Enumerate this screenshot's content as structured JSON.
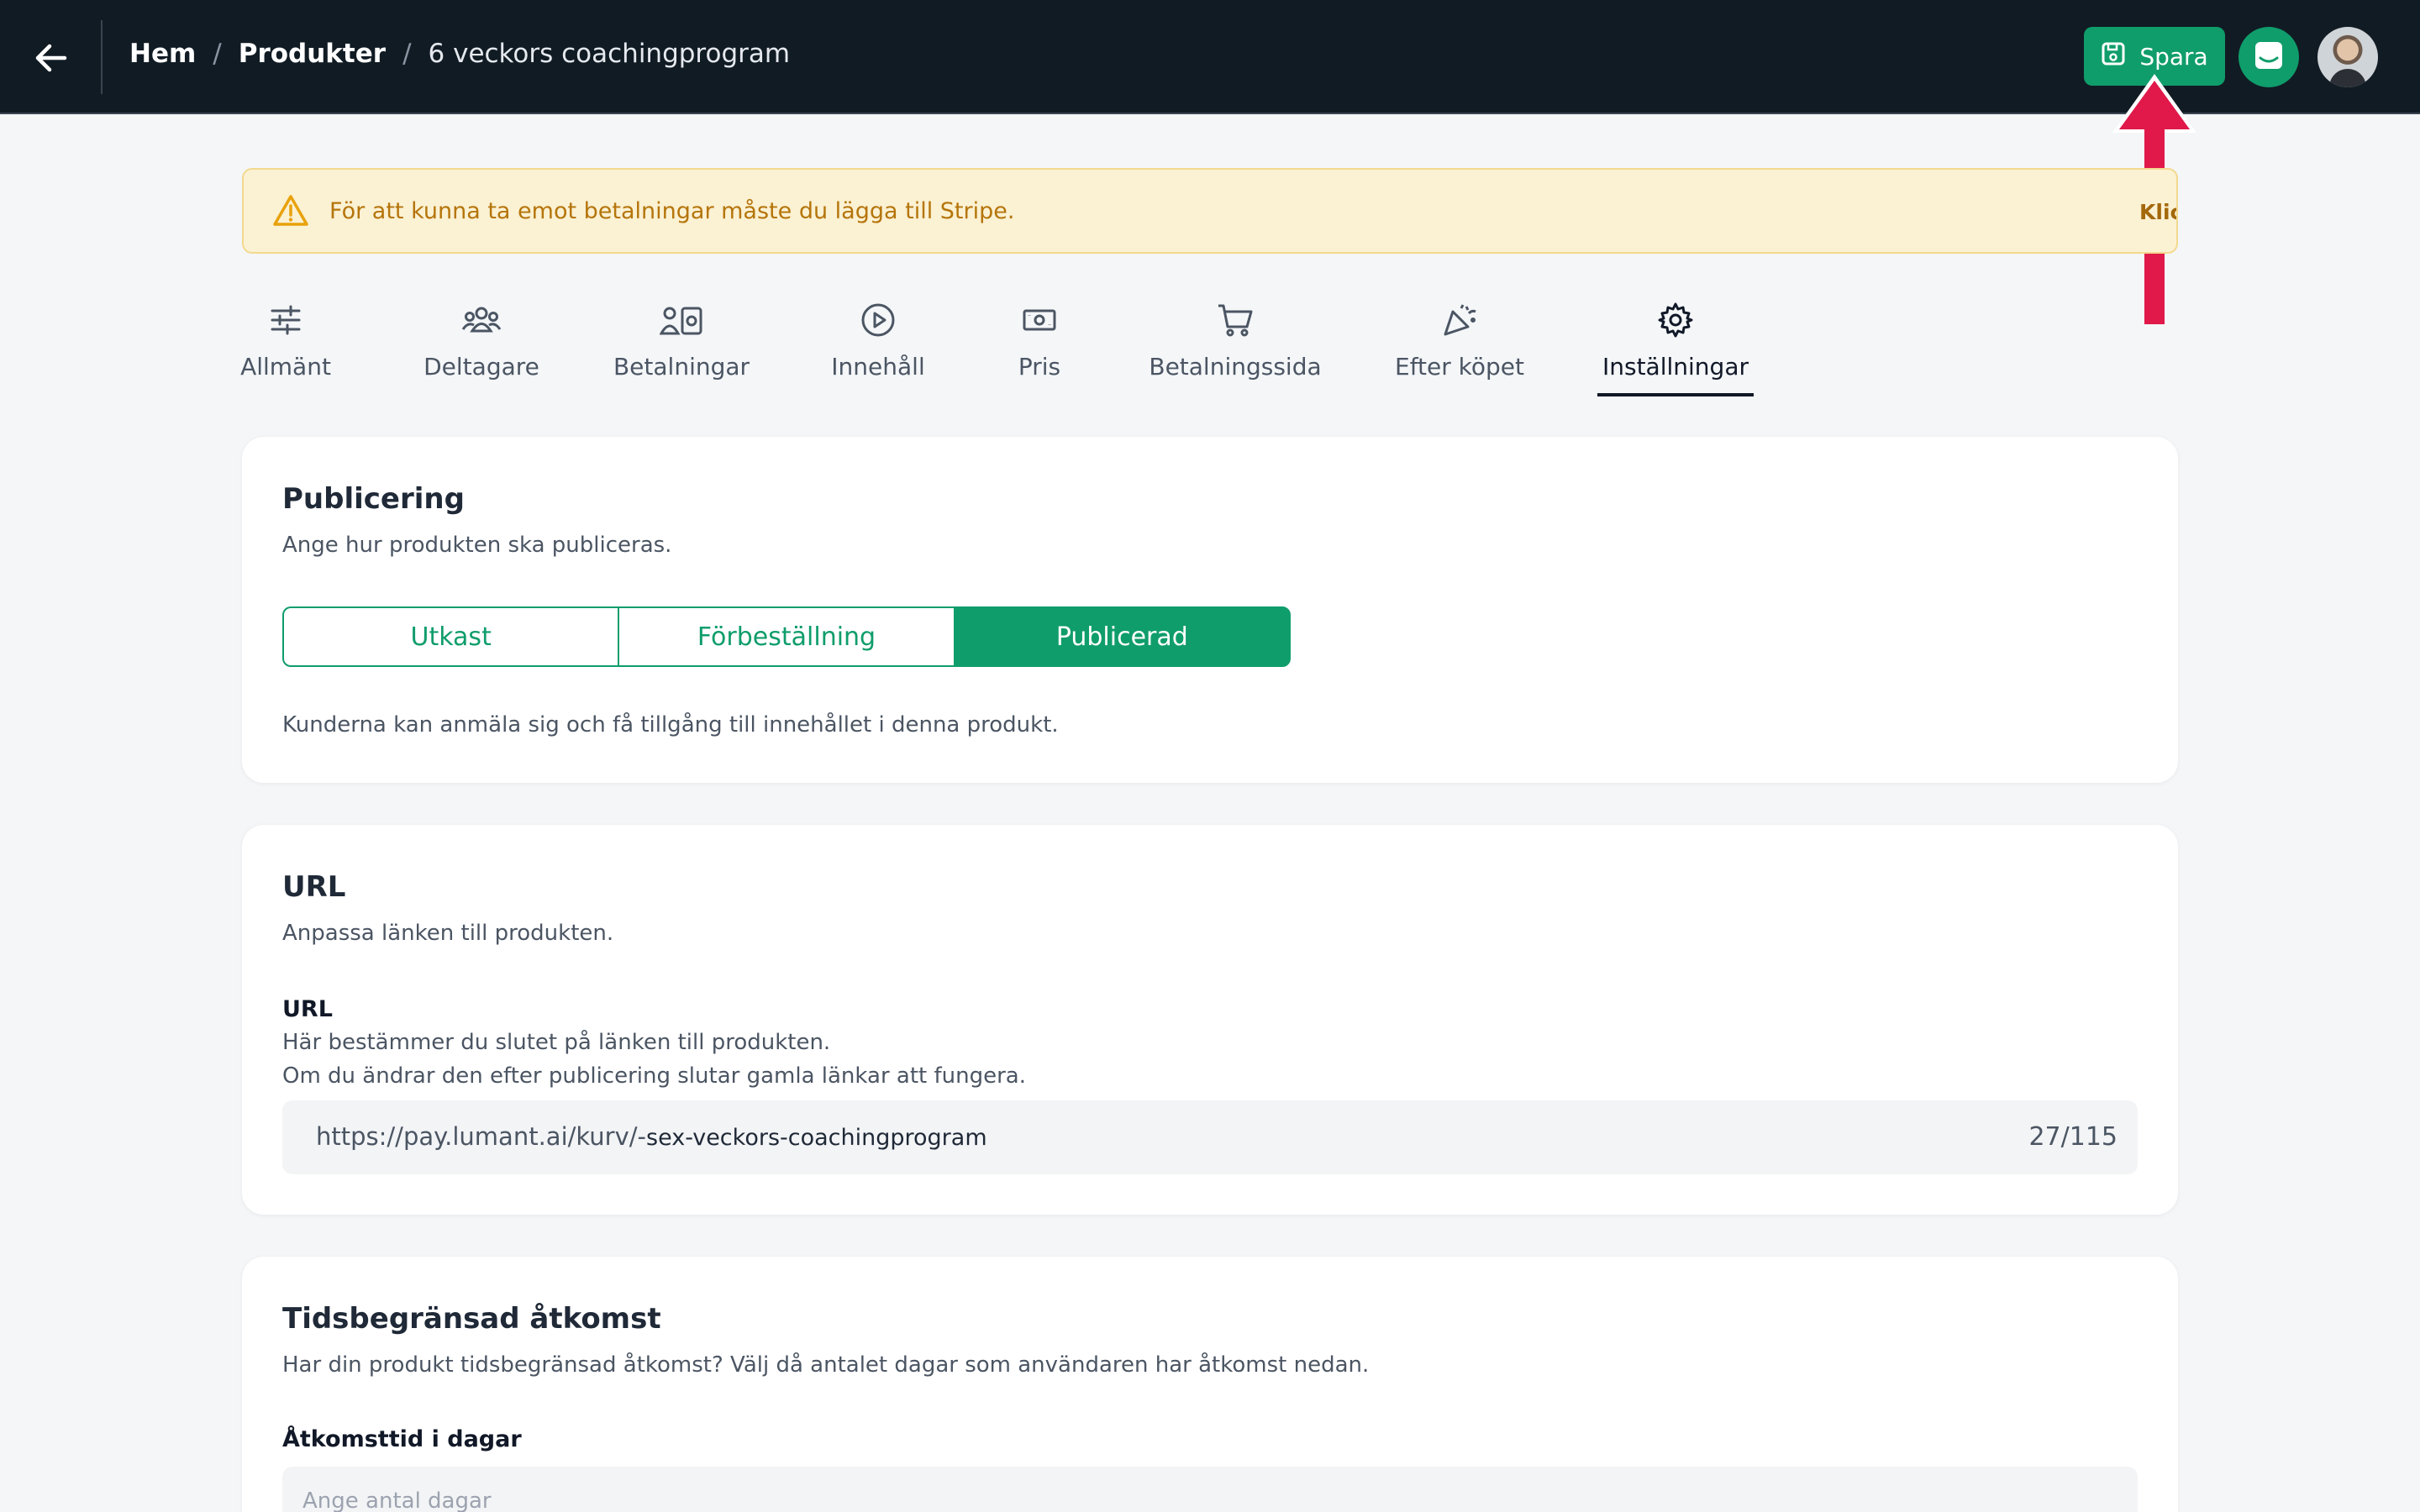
{
  "topbar": {
    "back_icon": "arrow-left-icon",
    "breadcrumb": {
      "home": "Hem",
      "separator": "/",
      "products": "Produkter",
      "current": "6 veckors coachingprogram"
    },
    "save_label": "Spara",
    "save_icon": "floppy-disk-icon",
    "chat_icon": "chat-icon",
    "accent_color": "#0f9d6b"
  },
  "warning": {
    "icon": "warning-triangle-icon",
    "text": "För att kunna ta emot betalningar måste du lägga till Stripe.",
    "link": "Klicka här för att göra det"
  },
  "tabs": [
    {
      "label": "Allmänt",
      "icon": "sliders-icon"
    },
    {
      "label": "Deltagare",
      "icon": "users-icon"
    },
    {
      "label": "Betalningar",
      "icon": "payments-icon"
    },
    {
      "label": "Innehåll",
      "icon": "play-circle-icon"
    },
    {
      "label": "Pris",
      "icon": "banknote-icon"
    },
    {
      "label": "Betalningssida",
      "icon": "cart-icon"
    },
    {
      "label": "Efter köpet",
      "icon": "party-popper-icon"
    },
    {
      "label": "Inställningar",
      "icon": "gear-icon",
      "active": true
    }
  ],
  "publishing": {
    "title": "Publicering",
    "description": "Ange hur produkten ska publiceras.",
    "options": [
      "Utkast",
      "Förbeställning",
      "Publicerad"
    ],
    "selected": "Publicerad",
    "info": "Kunderna kan anmäla sig och få tillgång till innehållet i denna produkt."
  },
  "url_card": {
    "title": "URL",
    "description": "Anpassa länken till produkten.",
    "field_label": "URL",
    "hint_1": "Här bestämmer du slutet på länken till produkten.",
    "hint_2": "Om du ändrar den efter publicering slutar gamla länkar att fungera.",
    "prefix": "https://pay.lumant.ai/kurv/-",
    "value": "sex-veckors-coachingprogram",
    "counter": "27/115"
  },
  "access_card": {
    "title": "Tidsbegränsad åtkomst",
    "description": "Har din produkt tidsbegränsad åtkomst? Välj då antalet dagar som användaren har åtkomst nedan.",
    "field_label": "Åtkomsttid i dagar",
    "placeholder": "Ange antal dagar"
  }
}
